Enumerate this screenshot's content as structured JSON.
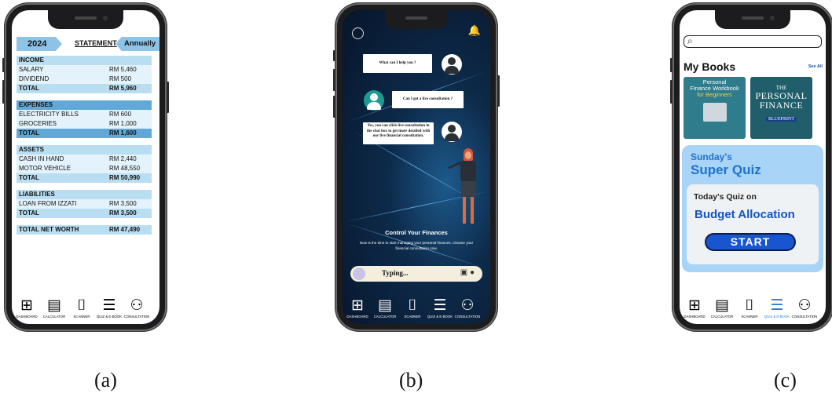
{
  "phone_a": {
    "year": "2024",
    "title": "STATEMENT",
    "period": "Annually",
    "rows": [
      {
        "label": "INCOME",
        "value": "",
        "kind": "h"
      },
      {
        "label": "SALARY",
        "value": "RM 5,460",
        "kind": "i"
      },
      {
        "label": "DIVIDEND",
        "value": "RM 500",
        "kind": "i"
      },
      {
        "label": "TOTAL",
        "value": "RM 5,960",
        "kind": "t"
      },
      {
        "label": "",
        "value": "",
        "kind": "g"
      },
      {
        "label": "EXPENSES",
        "value": "",
        "kind": "h2"
      },
      {
        "label": "ELECTRICITY BILLS",
        "value": "RM 600",
        "kind": "i"
      },
      {
        "label": "GROCERIES",
        "value": "RM 1,000",
        "kind": "i"
      },
      {
        "label": "TOTAL",
        "value": "RM 1,600",
        "kind": "tb"
      },
      {
        "label": "",
        "value": "",
        "kind": "g"
      },
      {
        "label": "ASSETS",
        "value": "",
        "kind": "h"
      },
      {
        "label": "CASH IN HAND",
        "value": "RM 2,440",
        "kind": "i"
      },
      {
        "label": "MOTOR VEHICLE",
        "value": "RM 48,550",
        "kind": "i"
      },
      {
        "label": "TOTAL",
        "value": "RM 50,990",
        "kind": "t"
      },
      {
        "label": "",
        "value": "",
        "kind": "g"
      },
      {
        "label": "LIABILITIES",
        "value": "",
        "kind": "h"
      },
      {
        "label": "LOAN FROM IZZATI",
        "value": "RM 3,500",
        "kind": "i"
      },
      {
        "label": "TOTAL",
        "value": "RM 3,500",
        "kind": "t"
      },
      {
        "label": "",
        "value": "",
        "kind": "g"
      },
      {
        "label": "TOTAL NET WORTH",
        "value": "RM 47,490",
        "kind": "nw"
      }
    ]
  },
  "nav": {
    "items": [
      {
        "label": "DASHBOARD",
        "icon": "dashboard-icon",
        "glyph": "⊞"
      },
      {
        "label": "CALCULATOR",
        "icon": "calculator-icon",
        "glyph": "▤"
      },
      {
        "label": "SCANNER",
        "icon": "scanner-icon",
        "glyph": "⌷"
      },
      {
        "label": "QUIZ & E-BOOK",
        "icon": "ebook-icon",
        "glyph": "☰"
      },
      {
        "label": "CONSULTATION",
        "icon": "consultation-icon",
        "glyph": "⚇"
      }
    ]
  },
  "phone_b": {
    "msg1": "What can I help you ?",
    "msg2": "Can I get a live consultation ?",
    "msg3": "Yes, you can click live consultation in the chat box to get more detailed with our live financial consultation.",
    "heading": "Control Your Finances",
    "subtext": "Now is the time to start managing your personal finances. Choose your financial consultation now.",
    "input_text": "Typing..."
  },
  "phone_c": {
    "search_placeholder": "",
    "section_title": "My Books",
    "see_all": "See All",
    "book1": {
      "line1": "Personal",
      "line2": "Finance Workbook",
      "line3": "for Beginners"
    },
    "book2": {
      "line1": "THE",
      "line2": "PERSONAL",
      "line3": "FINANCE",
      "line4": "BLUEPRINT"
    },
    "quiz_day": "Sunday's",
    "quiz_title": "Super Quiz",
    "quiz_today": "Today's Quiz on",
    "quiz_topic": "Budget Allocation",
    "start_label": "START",
    "active_nav": "QUIZ & E-BOOK"
  },
  "captions": [
    "(a)",
    "(b)",
    "(c)"
  ],
  "colors": {
    "table_header": "#b9def2",
    "table_header_dark": "#5fa8d8",
    "quiz_blue": "#1f73c8",
    "start_button": "#1a55d0",
    "chat_teal": "#1f9a8f"
  }
}
